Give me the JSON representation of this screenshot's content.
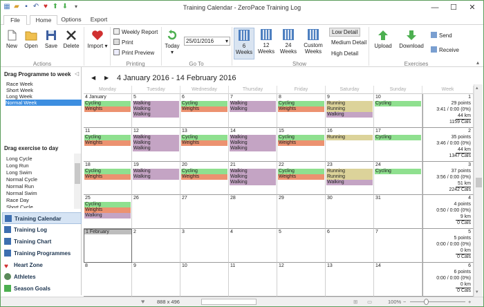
{
  "window": {
    "title": "Training Calendar - ZeroPace Training Log"
  },
  "tabs": [
    "File",
    "Home",
    "Options",
    "Export"
  ],
  "ribbon": {
    "actions": {
      "new": "New",
      "open": "Open",
      "save": "Save",
      "delete": "Delete",
      "group": "Actions"
    },
    "import": "Import",
    "printing": {
      "weekly": "Weekly Report",
      "print": "Print",
      "preview": "Print Preview",
      "group": "Printing"
    },
    "goto": {
      "today": "Today",
      "date": "25/01/2016",
      "group": "Go To"
    },
    "show": {
      "weeks": [
        [
          "6",
          "Weeks"
        ],
        [
          "12",
          "Weeks"
        ],
        [
          "24",
          "Weeks"
        ],
        [
          "Custom",
          "Weeks"
        ]
      ],
      "details": [
        "Low Detail",
        "Medium Detail",
        "High Detail"
      ],
      "group": "Show"
    },
    "exercises": {
      "upload": "Upload",
      "download": "Download",
      "send": "Send",
      "receive": "Receive",
      "group": "Exercises"
    }
  },
  "sidebar": {
    "programme_title": "Drag Programme to week",
    "programmes": [
      "Race Week",
      "Short Week",
      "Long Week",
      "Normal Week"
    ],
    "exercise_title": "Drag exercise to day",
    "exercises": [
      "Long Cycle",
      "Long Run",
      "Long Swim",
      "Normal Cycle",
      "Normal Run",
      "Normal Swim",
      "Race Day",
      "Short Cycle"
    ],
    "nav": [
      "Training Calendar",
      "Training Log",
      "Training Chart",
      "Training Programmes",
      "Heart Zone",
      "Athletes",
      "Season Goals"
    ]
  },
  "calendar": {
    "range": "4 January 2016 - 14 February 2016",
    "days": [
      "Monday",
      "Tuesday",
      "Wednesday",
      "Thursday",
      "Friday",
      "Saturday",
      "Sunday",
      "Week"
    ],
    "weeks": [
      {
        "num": "1",
        "days": [
          {
            "label": "4 January",
            "acts": [
              "Cycling",
              "Weights"
            ]
          },
          {
            "label": "5",
            "acts": [
              "Walking",
              "Walking",
              "Walking"
            ]
          },
          {
            "label": "6",
            "acts": [
              "Cycling",
              "Weights"
            ]
          },
          {
            "label": "7",
            "acts": [
              "Walking",
              "Walking"
            ]
          },
          {
            "label": "8",
            "acts": [
              "Cycling",
              "Weights"
            ]
          },
          {
            "label": "9",
            "acts": [
              "Running",
              "Running",
              "Walking"
            ]
          },
          {
            "label": "10",
            "acts": [
              "Cycling"
            ]
          }
        ],
        "summary": [
          "29 points",
          "3:41 / 0:00 (0%)",
          "44 km",
          "1159 Cals"
        ]
      },
      {
        "num": "2",
        "days": [
          {
            "label": "11",
            "acts": [
              "Cycling",
              "Weights"
            ]
          },
          {
            "label": "12",
            "acts": [
              "Walking",
              "Walking",
              "Walking"
            ]
          },
          {
            "label": "13",
            "acts": [
              "Cycling",
              "Weights"
            ]
          },
          {
            "label": "14",
            "acts": [
              "Walking",
              "Walking",
              "Walking"
            ]
          },
          {
            "label": "15",
            "acts": [
              "Cycling",
              "Weights"
            ]
          },
          {
            "label": "16",
            "acts": [
              "Running"
            ]
          },
          {
            "label": "17",
            "acts": [
              "Cycling"
            ]
          }
        ],
        "summary": [
          "35 points",
          "3:46 / 0:00 (0%)",
          "44 km",
          "1347 Cals"
        ]
      },
      {
        "num": "3",
        "days": [
          {
            "label": "18",
            "acts": [
              "Cycling",
              "Weights"
            ]
          },
          {
            "label": "19",
            "acts": [
              "Walking",
              "Walking"
            ]
          },
          {
            "label": "20",
            "acts": [
              "Cycling",
              "Weights"
            ]
          },
          {
            "label": "21",
            "acts": [
              "Walking",
              "Walking",
              "Walking"
            ]
          },
          {
            "label": "22",
            "acts": [
              "Cycling",
              "Weights"
            ]
          },
          {
            "label": "23",
            "acts": [
              "Running",
              "Running",
              "Walking"
            ]
          },
          {
            "label": "24",
            "acts": [
              "Cycling"
            ]
          }
        ],
        "summary": [
          "37 points",
          "3:56 / 0:00 (0%)",
          "51 km",
          "2242 Cals"
        ]
      },
      {
        "num": "4",
        "days": [
          {
            "label": "25",
            "acts": [
              "Cycling",
              "Weights",
              "Walking"
            ]
          },
          {
            "label": "26",
            "acts": []
          },
          {
            "label": "27",
            "acts": []
          },
          {
            "label": "28",
            "acts": []
          },
          {
            "label": "29",
            "acts": []
          },
          {
            "label": "30",
            "acts": []
          },
          {
            "label": "31",
            "acts": []
          }
        ],
        "summary": [
          "4 points",
          "0:50 / 0:00 (0%)",
          "9 km",
          "0 Cals"
        ]
      },
      {
        "num": "5",
        "days": [
          {
            "label": "1 February",
            "acts": []
          },
          {
            "label": "2",
            "acts": []
          },
          {
            "label": "3",
            "acts": []
          },
          {
            "label": "4",
            "acts": []
          },
          {
            "label": "5",
            "acts": []
          },
          {
            "label": "6",
            "acts": []
          },
          {
            "label": "7",
            "acts": []
          }
        ],
        "summary": [
          "5 points",
          "0:00 / 0:00 (0%)",
          "0 km",
          "0 Cals"
        ]
      },
      {
        "num": "6",
        "days": [
          {
            "label": "8",
            "acts": []
          },
          {
            "label": "9",
            "acts": []
          },
          {
            "label": "10",
            "acts": []
          },
          {
            "label": "11",
            "acts": []
          },
          {
            "label": "12",
            "acts": []
          },
          {
            "label": "13",
            "acts": []
          },
          {
            "label": "14",
            "acts": []
          }
        ],
        "summary": [
          "6 points",
          "0:00 / 0:00 (0%)",
          "0 km",
          "0 Cals"
        ]
      }
    ]
  },
  "colors": {
    "Cycling": "#8fe08f",
    "Weights": "#ec9270",
    "Walking": "#c4a4c4",
    "Running": "#dcd39a",
    "accent": "#3d8ee0"
  },
  "status": {
    "size": "888 x 496",
    "zoom": "100%"
  }
}
